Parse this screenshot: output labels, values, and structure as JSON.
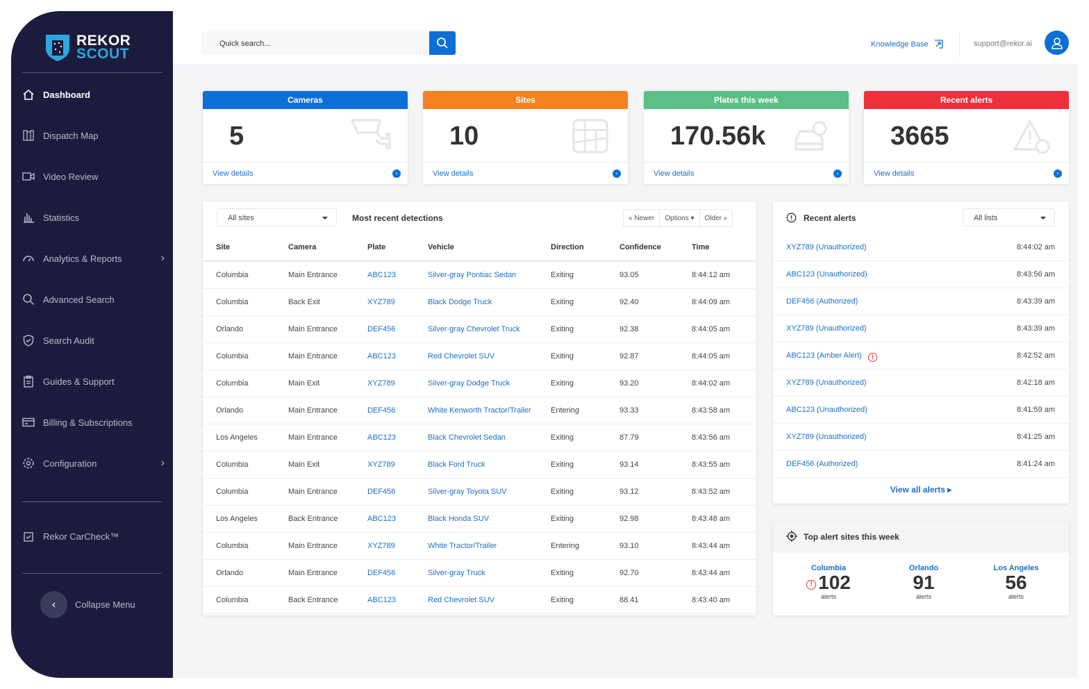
{
  "brand": {
    "line1": "REKOR",
    "line2": "SCOUT"
  },
  "sidebar": {
    "items": [
      {
        "label": "Dashboard",
        "icon": "home-icon",
        "active": true
      },
      {
        "label": "Dispatch Map",
        "icon": "map-icon"
      },
      {
        "label": "Video Review",
        "icon": "video-icon"
      },
      {
        "label": "Statistics",
        "icon": "bar-chart-icon"
      },
      {
        "label": "Analytics & Reports",
        "icon": "gauge-icon",
        "chevron": true
      },
      {
        "label": "Advanced Search",
        "icon": "search-icon"
      },
      {
        "label": "Search Audit",
        "icon": "shield-check-icon"
      },
      {
        "label": "Guides & Support",
        "icon": "clipboard-icon"
      },
      {
        "label": "Billing & Subscriptions",
        "icon": "credit-card-icon"
      },
      {
        "label": "Configuration",
        "icon": "gear-icon",
        "chevron": true
      }
    ],
    "carcheck": "Rekor CarCheck™",
    "collapse": "Collapse Menu"
  },
  "header": {
    "search_placeholder": "Quick search...",
    "knowledge_base": "Knowledge Base",
    "email": "support@rekor.ai"
  },
  "cards": [
    {
      "title": "Cameras",
      "value": "5",
      "color": "#0c6fd6",
      "link": "View details",
      "icon": "camera-icon"
    },
    {
      "title": "Sites",
      "value": "10",
      "color": "#f5821f",
      "link": "View details",
      "icon": "map-pin-icon"
    },
    {
      "title": "Plates this week",
      "value": "170.56k",
      "color": "#5cbf86",
      "link": "View details",
      "icon": "car-search-icon"
    },
    {
      "title": "Recent alerts",
      "value": "3665",
      "color": "#ee2f3c",
      "link": "View details",
      "icon": "warning-icon"
    }
  ],
  "detections": {
    "filter": "All sites",
    "title": "Most recent detections",
    "newer": "« Newer",
    "options": "Options",
    "older": "Older »",
    "columns": [
      "Site",
      "Camera",
      "Plate",
      "Vehicle",
      "Direction",
      "Confidence",
      "Time"
    ],
    "rows": [
      [
        "Columbia",
        "Main Entrance",
        "ABC123",
        "Silver-gray Pontiac Sedan",
        "Exiting",
        "93.05",
        "8:44:12 am"
      ],
      [
        "Columbia",
        "Back Exit",
        "XYZ789",
        "Black Dodge Truck",
        "Exiting",
        "92.40",
        "8:44:09 am"
      ],
      [
        "Orlando",
        "Main Entrance",
        "DEF456",
        "Silver-gray Chevrolet Truck",
        "Exiting",
        "92.38",
        "8:44:05 am"
      ],
      [
        "Columbia",
        "Main Entrance",
        "ABC123",
        "Red Chevrolet SUV",
        "Exiting",
        "92.87",
        "8:44:05 am"
      ],
      [
        "Columbia",
        "Main Exit",
        "XYZ789",
        "Silver-gray Dodge Truck",
        "Exiting",
        "93.20",
        "8:44:02 am"
      ],
      [
        "Orlando",
        "Main Entrance",
        "DEF456",
        "White Kenworth Tractor/Trailer",
        "Entering",
        "93.33",
        "8:43:58 am"
      ],
      [
        "Los Angeles",
        "Main Entrance",
        "ABC123",
        "Black Chevrolet Sedan",
        "Exiting",
        "87.79",
        "8:43:56 am"
      ],
      [
        "Columbia",
        "Main Exit",
        "XYZ789",
        "Black Ford Truck",
        "Exiting",
        "93.14",
        "8:43:55 am"
      ],
      [
        "Columbia",
        "Main Entrance",
        "DEF456",
        "Silver-gray Toyota SUV",
        "Exiting",
        "93.12",
        "8:43:52 am"
      ],
      [
        "Los Angeles",
        "Back Entrance",
        "ABC123",
        "Black Honda SUV",
        "Exiting",
        "92.98",
        "8:43:48 am"
      ],
      [
        "Columbia",
        "Main Entrance",
        "XYZ789",
        "White Tractor/Trailer",
        "Entering",
        "93.10",
        "8:43:44 am"
      ],
      [
        "Orlando",
        "Main Entrance",
        "DEF456",
        "Silver-gray Truck",
        "Exiting",
        "92.70",
        "8:43:44 am"
      ],
      [
        "Columbia",
        "Back Entrance",
        "ABC123",
        "Red Chevrolet SUV",
        "Exiting",
        "88.41",
        "8:43:40 am"
      ]
    ]
  },
  "alerts": {
    "title": "Recent alerts",
    "filter": "All lists",
    "view_all": "View all alerts",
    "rows": [
      {
        "label": "XYZ789 (Unauthorized)",
        "time": "8:44:02 am"
      },
      {
        "label": "ABC123 (Unauthorized)",
        "time": "8:43:56 am"
      },
      {
        "label": "DEF456 (Authorized)",
        "time": "8:43:39 am"
      },
      {
        "label": "XYZ789 (Unauthorized)",
        "time": "8:43:39 am"
      },
      {
        "label": "ABC123 (Amber Alert)",
        "time": "8:42:52 am",
        "flag": true
      },
      {
        "label": "XYZ789 (Unauthorized)",
        "time": "8:42:18 am"
      },
      {
        "label": "ABC123 (Unauthorized)",
        "time": "8:41:59 am"
      },
      {
        "label": "XYZ789 (Unauthorized)",
        "time": "8:41:25 am"
      },
      {
        "label": "DEF456 (Authorized)",
        "time": "8:41:24 am"
      }
    ]
  },
  "top_sites": {
    "title": "Top alert sites this week",
    "sites": [
      {
        "name": "Columbia",
        "count": "102",
        "unit": "alerts",
        "flag": true
      },
      {
        "name": "Orlando",
        "count": "91",
        "unit": "alerts"
      },
      {
        "name": "Los Angeles",
        "count": "56",
        "unit": "alerts"
      }
    ]
  }
}
